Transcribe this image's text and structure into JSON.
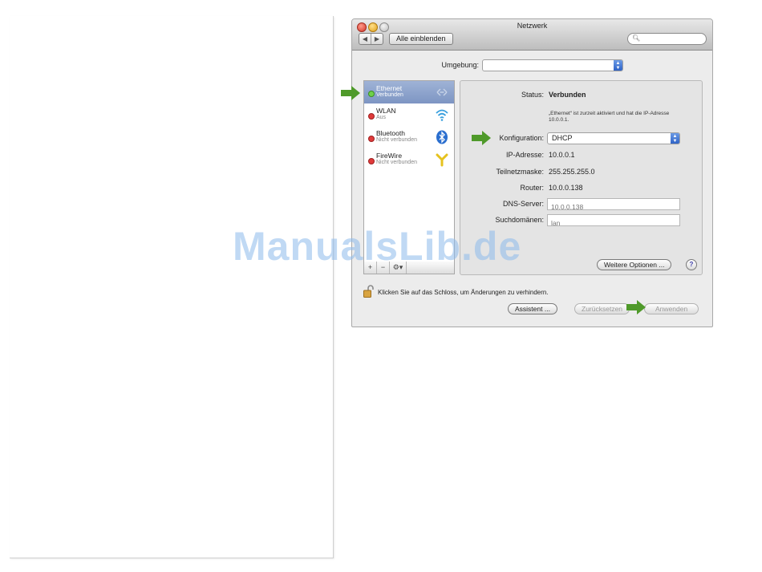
{
  "window": {
    "title": "Netzwerk",
    "back_label": "◀",
    "forward_label": "▶",
    "show_all_label": "Alle einblenden",
    "search_value": ""
  },
  "location": {
    "label": "Umgebung:",
    "value": ""
  },
  "services": [
    {
      "name": "Ethernet",
      "status": "Verbunden",
      "status_color": "green",
      "icon": "ethernet-icon",
      "selected": true
    },
    {
      "name": "WLAN",
      "status": "Aus",
      "status_color": "red",
      "icon": "wifi-icon",
      "selected": false
    },
    {
      "name": "Bluetooth",
      "status": "Nicht verbunden",
      "status_color": "red",
      "icon": "bluetooth-icon",
      "selected": false
    },
    {
      "name": "FireWire",
      "status": "Nicht verbunden",
      "status_color": "red",
      "icon": "firewire-icon",
      "selected": false
    }
  ],
  "list_controls": {
    "add": "+",
    "remove": "−",
    "gear": "⚙▾"
  },
  "details": {
    "status_label": "Status:",
    "status_value": "Verbunden",
    "status_note": "„Ethernet“ ist zurzeit aktiviert und hat die IP-Adresse 10.0.0.1.",
    "config_label": "Konfiguration:",
    "config_value": "DHCP",
    "ip_label": "IP-Adresse:",
    "ip_value": "10.0.0.1",
    "mask_label": "Teilnetzmaske:",
    "mask_value": "255.255.255.0",
    "router_label": "Router:",
    "router_value": "10.0.0.138",
    "dns_label": "DNS-Server:",
    "dns_placeholder": "10.0.0.138",
    "search_domains_label": "Suchdomänen:",
    "search_domains_placeholder": "lan",
    "more_options_label": "Weitere Optionen ...",
    "help_label": "?"
  },
  "footer": {
    "lock_text": "Klicken Sie auf das Schloss, um Änderungen zu verhindern.",
    "assistant_label": "Assistent ...",
    "revert_label": "Zurücksetzen",
    "apply_label": "Anwenden"
  },
  "watermark": "ManualsLib.de",
  "colors": {
    "selection": "#7d95c3",
    "status_green": "#6fd14a",
    "status_red": "#e03a3a",
    "arrow_green": "#4f9a2a",
    "watermark": "#8cb9eb"
  }
}
